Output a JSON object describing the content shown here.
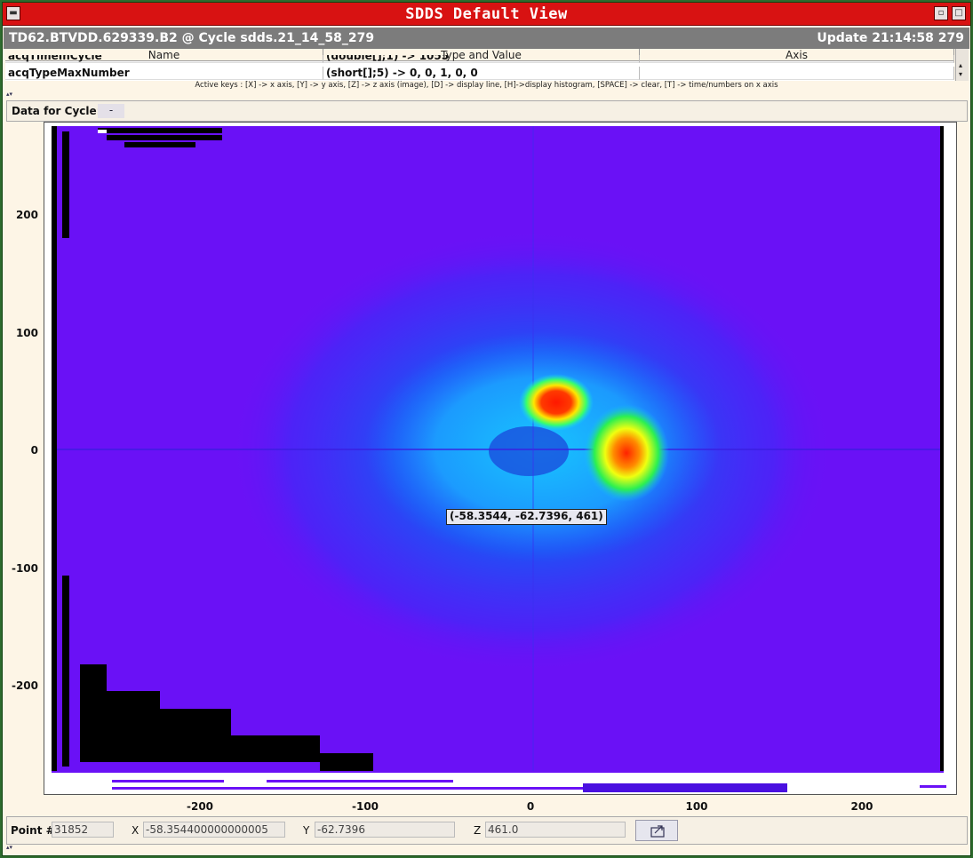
{
  "window": {
    "title": "SDDS Default View"
  },
  "header": {
    "device": "TD62.BTVDD.629339.B2 @ Cycle sdds.21_14_58_279",
    "update": "Update 21:14:58 279"
  },
  "table": {
    "columns": [
      "Name",
      "Type and Value",
      "Axis"
    ],
    "rows": [
      {
        "name": "acqTimeInCycle",
        "value": "(double[];1) -> 1055"
      },
      {
        "name": "acqTypeMaxNumber",
        "value": "(short[];5) -> 0, 0, 1, 0, 0"
      }
    ]
  },
  "keys_help": "Active keys : [X] -> x axis, [Y] -> y axis, [Z] -> z axis (image), [D] -> display line, [H]->display histogram, [SPACE] -> clear, [T] -> time/numbers on x axis",
  "cycle": {
    "label": "Data for Cycle:",
    "value": "-"
  },
  "plot": {
    "x_ticks": [
      "-200",
      "-100",
      "0",
      "100",
      "200"
    ],
    "y_ticks": [
      "200",
      "100",
      "0",
      "-100",
      "-200"
    ],
    "xlim": [
      -287,
      253
    ],
    "ylim": [
      -275,
      277
    ],
    "tooltip": "(-58.3544, -62.7396, 461)",
    "colors": {
      "background": "#6a11f6",
      "peak": "#ff1e00"
    }
  },
  "status": {
    "point_label": "Point #",
    "point_value": "31852",
    "x_label": "X",
    "x_value": "-58.354400000000005",
    "y_label": "Y",
    "y_value": "-62.7396",
    "z_label": "Z",
    "z_value": "461.0",
    "export_icon": "export-icon"
  }
}
